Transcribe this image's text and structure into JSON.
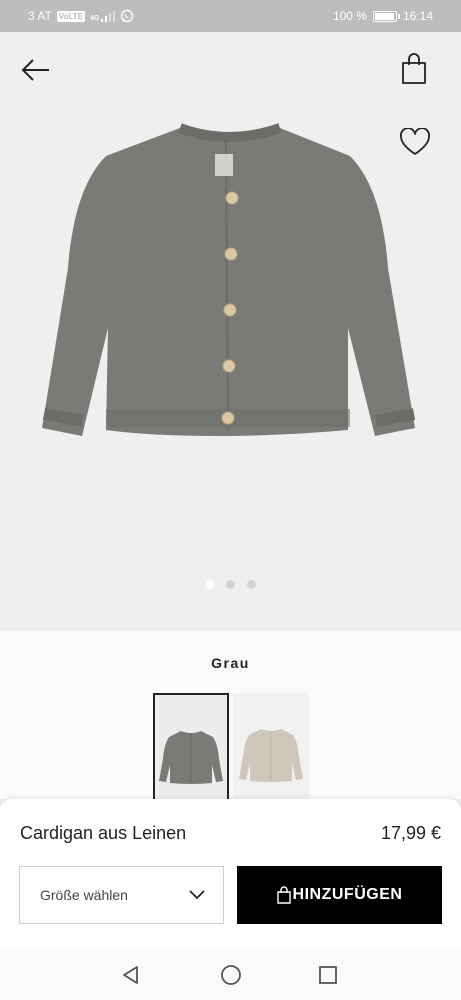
{
  "status_bar": {
    "carrier": "3 AT",
    "volte": "VoLTE",
    "network": "4G",
    "battery": "100 %",
    "battery_level": 1.0,
    "time": "16:14"
  },
  "header": {
    "back_icon": "arrow-left-icon",
    "bag_icon": "shopping-bag-icon",
    "favorite_icon": "heart-outline-icon"
  },
  "gallery": {
    "image_count": 3,
    "active_index": 0
  },
  "variants": {
    "selected_color": "Grau",
    "swatches": [
      {
        "color_hex": "#7a7a76",
        "selected": true
      },
      {
        "color_hex": "#cfc7bb",
        "selected": false
      }
    ]
  },
  "product": {
    "name": "Cardigan aus Leinen",
    "price": "17,99 €",
    "size_placeholder": "Größe wählen",
    "add_to_cart": "HINZUFÜGEN"
  },
  "colors": {
    "accent": "#000000",
    "garment": "#7a7a76",
    "background": "#efefef"
  },
  "nav": {
    "back_icon": "triangle-back-icon",
    "home_icon": "circle-home-icon",
    "recent_icon": "square-recent-icon"
  }
}
